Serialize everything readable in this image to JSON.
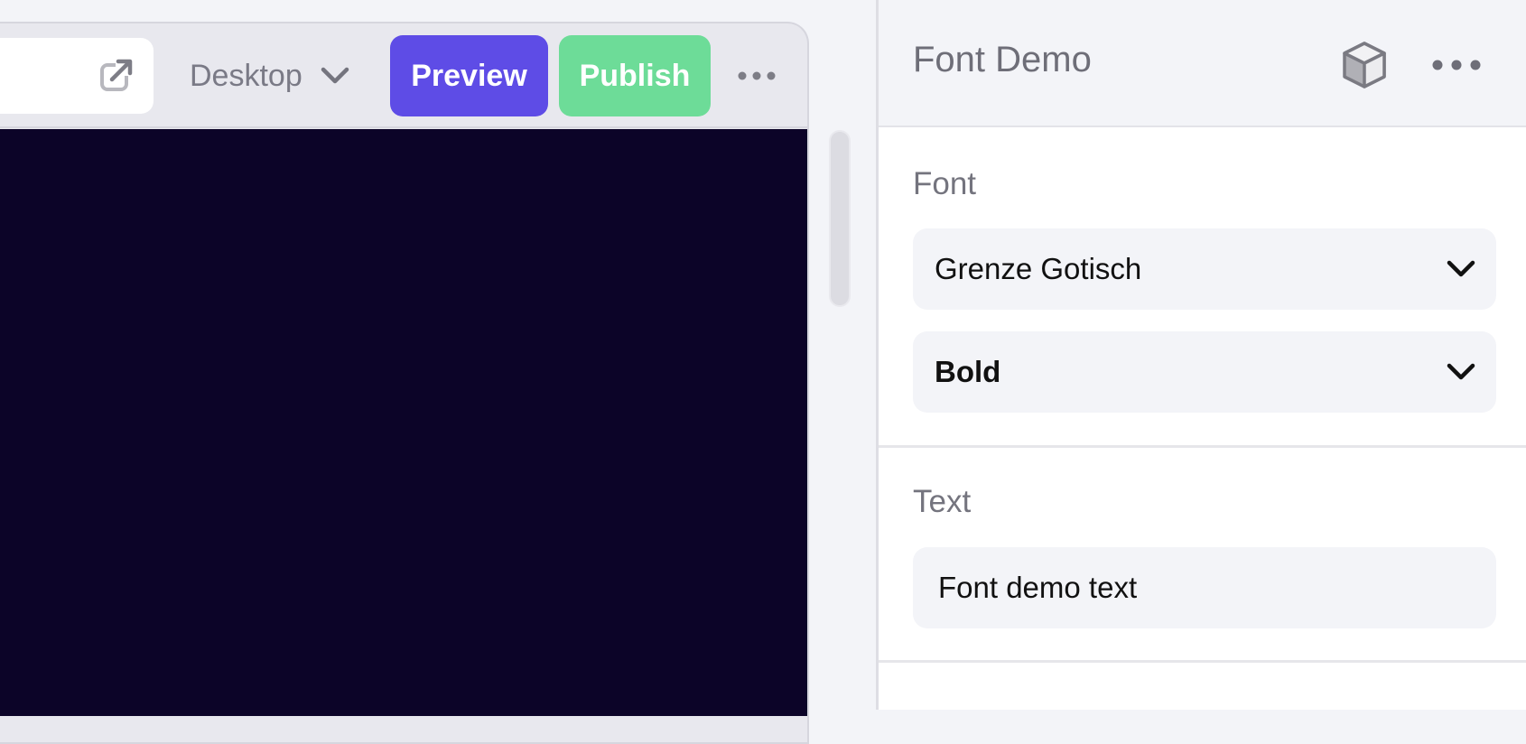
{
  "toolbar": {
    "device": {
      "selected": "Desktop",
      "icon": "chevron-down-icon"
    },
    "preview_label": "Preview",
    "publish_label": "Publish",
    "external_icon": "external-link-icon",
    "more_icon": "more-horizontal-icon"
  },
  "canvas": {
    "background": "#0c0428"
  },
  "panel": {
    "title": "Font Demo",
    "header_icons": [
      "cube-icon",
      "more-horizontal-icon"
    ],
    "font_section": {
      "label": "Font",
      "family": "Grenze Gotisch",
      "weight": "Bold"
    },
    "text_section": {
      "label": "Text",
      "value": "Font demo text"
    }
  },
  "colors": {
    "preview": "#5e4ce6",
    "publish": "#6ddc98",
    "canvas": "#0c0428"
  }
}
